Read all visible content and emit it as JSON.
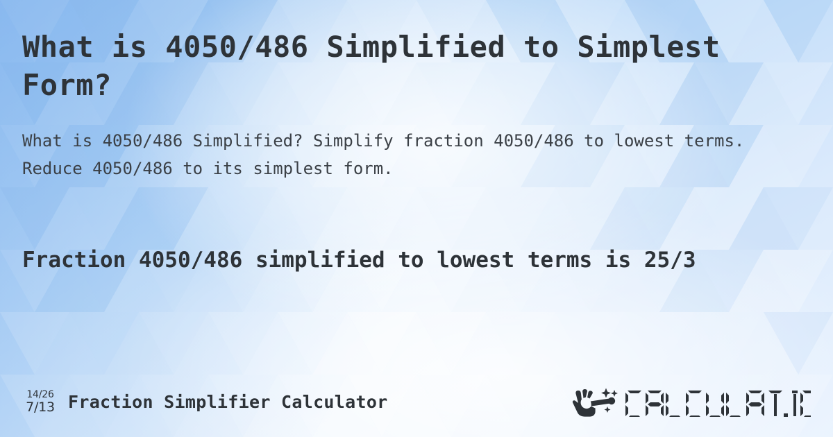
{
  "meta": {
    "accent_blue": "#8cbdf0",
    "background_light": "#eef5fd",
    "text_dark": "#2e3338",
    "text_body": "#3b4046"
  },
  "header": {
    "title": "What is 4050/486 Simplified to Simplest Form?"
  },
  "description": {
    "text": "What is 4050/486 Simplified? Simplify fraction 4050/486 to lowest terms. Reduce 4050/486 to its simplest form."
  },
  "result": {
    "text": "Fraction 4050/486 simplified to lowest terms is 25/3",
    "numerator": "4050",
    "denominator": "486",
    "simplified": "25/3"
  },
  "footer": {
    "icon": {
      "name": "fraction-simplify-icon",
      "top_fraction": "14/26",
      "bottom_fraction": "7/13"
    },
    "title": "Fraction Simplifier Calculator",
    "brand": {
      "name": "calculatio-logo",
      "wordmark": "CALCULAT.IO",
      "mark": "magic-wand-hand-icon"
    }
  }
}
